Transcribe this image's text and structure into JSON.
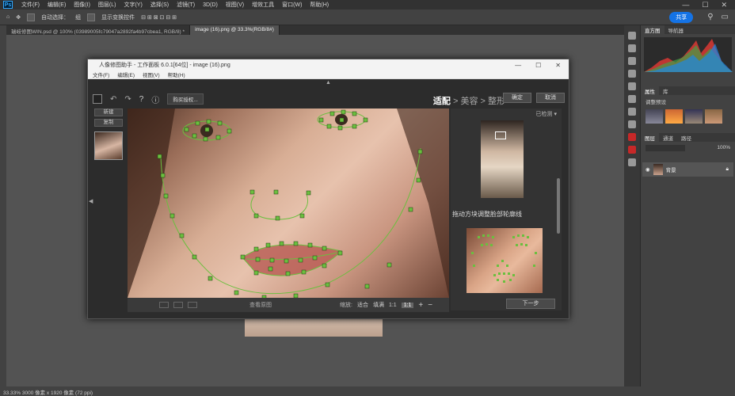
{
  "ps": {
    "logo": "Ps",
    "menu": [
      "文件(F)",
      "编辑(E)",
      "图像(I)",
      "图层(L)",
      "文字(Y)",
      "选择(S)",
      "滤镜(T)",
      "3D(D)",
      "视图(V)",
      "增效工具",
      "窗口(W)",
      "帮助(H)"
    ],
    "window_buttons": [
      "—",
      "☐",
      "✕"
    ],
    "options": {
      "auto_select": "自动选择：",
      "layer_select": "组",
      "show_transform": "显示变换控件",
      "share": "共享"
    },
    "tabs": [
      "瑞岐修图WIN.psd @ 100% (03989005fc79047a2892fa4b97cbea1, RGB/8) *",
      "image (16).png @ 33.3%(RGB/8#)"
    ],
    "status": "33.33%   3000 像素 x 1920 像素 (72 ppi)",
    "panels": {
      "top_tabs": [
        "直方图",
        "导航器"
      ],
      "mid_tabs": [
        "属性",
        "库"
      ],
      "adjust_label": "调整预设",
      "layer_tabs": [
        "图层",
        "通道",
        "路径"
      ],
      "opacity": "100%",
      "layer_name": "背景"
    }
  },
  "plugin": {
    "title": "人像修图助手 - 工作面板 6.0.1[64位] - image (16).png",
    "menu": [
      "文件(F)",
      "编辑(E)",
      "视图(V)",
      "帮助(H)"
    ],
    "tool_button": "购买授权...",
    "steps": {
      "current": "适配",
      "sep": " > ",
      "s2": "美容",
      "s3": "整形"
    },
    "confirm": "确定",
    "cancel": "取消",
    "left_buttons": [
      "新建",
      "复制"
    ],
    "reference_label": "已检测",
    "guide_text": "拖动方块调整脸部轮廓线",
    "next": "下一步",
    "view_original": "查看原图",
    "zoom": {
      "label": "缩放:",
      "fit": "适合",
      "fill": "填满",
      "one": "1:1",
      "ratio": "1:1",
      "plus": "+",
      "minus": "−"
    }
  }
}
